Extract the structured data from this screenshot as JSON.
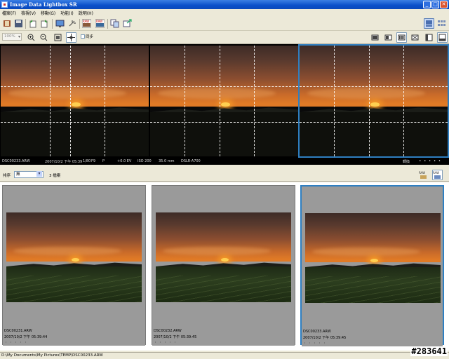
{
  "window": {
    "title": "Image Data Lightbox SR"
  },
  "menu": [
    "檔案(F)",
    "檢視(V)",
    "移動(G)",
    "功能(I)",
    "說明(H)"
  ],
  "toolbar2": {
    "zoom_value": "100%",
    "checkbox_label": "同步"
  },
  "preview": {
    "info": {
      "filename": "DSC00233.ARW",
      "datetime": "2007/10/2 下午 05:39",
      "shutter": "1/80",
      "aperture": "F9",
      "exposure_program": "P",
      "ev": "+0.0 EV",
      "iso": "ISO 200",
      "focal": "35.0 mm",
      "camera": "DSLR-A700"
    },
    "sync_label": "轉換"
  },
  "thumbbar": {
    "sort_label": "排序",
    "sort_value": "無",
    "count_label": "3 檔案"
  },
  "thumbnails": [
    {
      "filename": "DSC00231.ARW",
      "datetime": "2007/10/2 下午 05:39:44",
      "rating": "・・・・・"
    },
    {
      "filename": "DSC00232.ARW",
      "datetime": "2007/10/2 下午 05:39:45",
      "rating": "・・・・・"
    },
    {
      "filename": "DSC00233.ARW",
      "datetime": "2007/10/2 下午 05:39:45",
      "rating": "・・・・・"
    }
  ],
  "statusbar": {
    "path": "D:\\My Documents\\My Pictures\\TEMP\\DSC00233.ARW"
  },
  "watermark": "#283641",
  "colors": {
    "titlebar": "#0a4fc9",
    "selection": "#2f7fc1",
    "chrome": "#ece9d8"
  }
}
